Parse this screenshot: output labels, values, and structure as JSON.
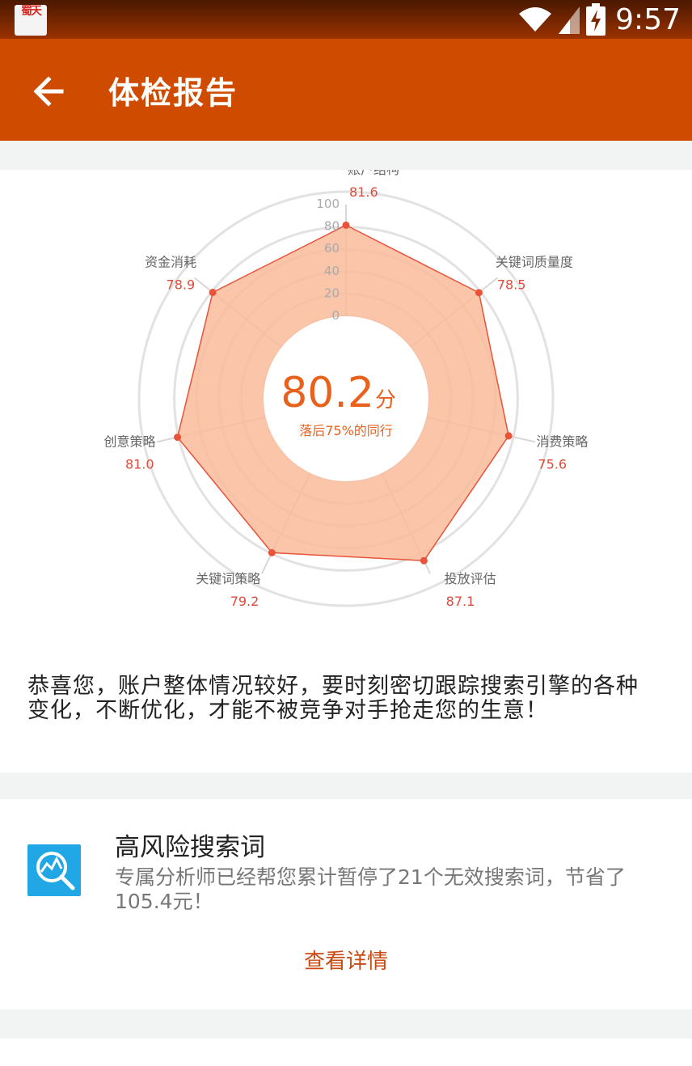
{
  "status_bar": {
    "app_icon_text": "蜀天",
    "time": "9:57",
    "icons": [
      "wifi-icon",
      "signal-icon",
      "battery-charging-icon"
    ]
  },
  "toolbar": {
    "title": "体检报告",
    "back_icon": "arrow-left-icon",
    "color": "#cf4b00"
  },
  "radar": {
    "score": "80.2",
    "score_unit": "分",
    "score_caption": "落后75%的同行",
    "scale_ticks": [
      "100",
      "80",
      "60",
      "40",
      "20",
      "0"
    ],
    "fill_color": "#f9bb9a",
    "stroke_color": "#e8533a",
    "axes": [
      {
        "label": "账户结构",
        "value": "81.6"
      },
      {
        "label": "关键词质量度",
        "value": "78.5"
      },
      {
        "label": "消费策略",
        "value": "75.6"
      },
      {
        "label": "投放评估",
        "value": "87.1"
      },
      {
        "label": "关键词策略",
        "value": "79.2"
      },
      {
        "label": "创意策略",
        "value": "81.0"
      },
      {
        "label": "资金消耗",
        "value": "78.9"
      }
    ]
  },
  "summary": {
    "text": "恭喜您，账户整体情况较好，要时刻密切跟踪搜索引擎的各种变化，不断优化，才能不被竞争对手抢走您的生意！"
  },
  "risk_card": {
    "icon": "search-analysis-icon",
    "title": "高风险搜索词",
    "description": "专属分析师已经帮您累计暂停了21个无效搜索词，节省了105.4元！",
    "link_label": "查看详情"
  }
}
